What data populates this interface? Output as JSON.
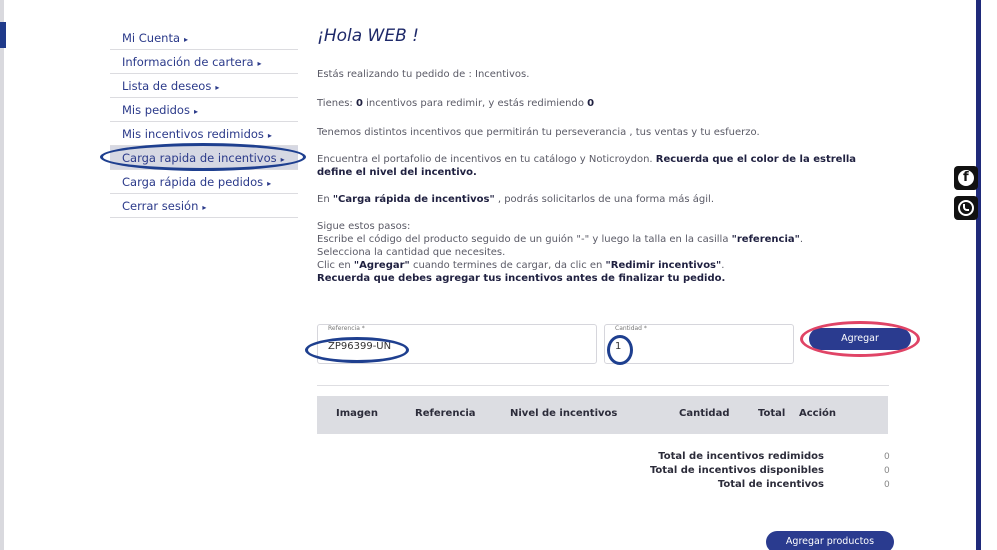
{
  "sidebar": {
    "items": [
      {
        "label": "Mi Cuenta",
        "caret": "▸"
      },
      {
        "label": "Información de cartera",
        "caret": "▸"
      },
      {
        "label": "Lista de deseos",
        "caret": "▸"
      },
      {
        "label": "Mis pedidos",
        "caret": "▸"
      },
      {
        "label": "Mis incentivos redimidos",
        "caret": "▸"
      },
      {
        "label": "Carga rapida de incentivos",
        "caret": "▸"
      },
      {
        "label": "Carga rápida de pedidos",
        "caret": "▸"
      },
      {
        "label": "Cerrar sesión",
        "caret": "▸"
      }
    ]
  },
  "main": {
    "greeting": "¡Hola WEB !",
    "order_line": "Estás realizando tu pedido de : Incentivos.",
    "incentives_prefix": "Tienes: ",
    "incentives_count": "0",
    "incentives_middle": " incentivos para redimir, y estás redimiendo ",
    "incentives_redeeming": "0",
    "distinct_line": "Tenemos distintos incentivos que permitirán tu perseverancia , tus ventas y tu esfuerzo.",
    "portfolio_line": "Encuentra el portafolio de incentivos en tu catálogo y Noticroydon. ",
    "portfolio_bold": "Recuerda que el color de la estrella define el nivel del incentivo.",
    "carga_prefix": "En ",
    "carga_bold": "\"Carga rápida de incentivos\"",
    "carga_suffix": " , podrás solicitarlos de una forma más ágil.",
    "steps_title": "Sigue estos pasos:",
    "step1_text": "Escribe el código del producto seguido de un guión \"-\" y luego la talla en la casilla ",
    "step1_bold": "\"referencia\"",
    "step1_end": ".",
    "step2_text": "Selecciona la cantidad que necesites.",
    "step3_prefix": "Clic en ",
    "step3_bold1": "\"Agregar\"",
    "step3_mid": " cuando termines de cargar, da clic en ",
    "step3_bold2": "\"Redimir incentivos\"",
    "step3_end": ".",
    "step4_bold": "Recuerda que debes agregar tus incentivos antes de finalizar tu pedido."
  },
  "form": {
    "reference_label": "Referencia *",
    "reference_value": "ZP96399-UN",
    "quantity_label": "Cantidad *",
    "quantity_value": "1",
    "add_button": "Agregar"
  },
  "table": {
    "headers": [
      "Imagen",
      "Referencia",
      "Nivel de incentivos",
      "Cantidad",
      "Total",
      "Acción"
    ]
  },
  "totals": [
    {
      "label": "Total de incentivos redimidos",
      "value": "0"
    },
    {
      "label": "Total de incentivos disponibles",
      "value": "0"
    },
    {
      "label": "Total de incentivos",
      "value": "0"
    }
  ],
  "footer": {
    "add_products_button": "Agregar productos"
  },
  "social": {
    "facebook_icon": "facebook-icon",
    "whatsapp_icon": "whatsapp-icon"
  },
  "colors": {
    "accent": "#2a3b8f",
    "highlight_oval_blue": "#1e3f8f",
    "highlight_oval_red": "#e04466"
  }
}
